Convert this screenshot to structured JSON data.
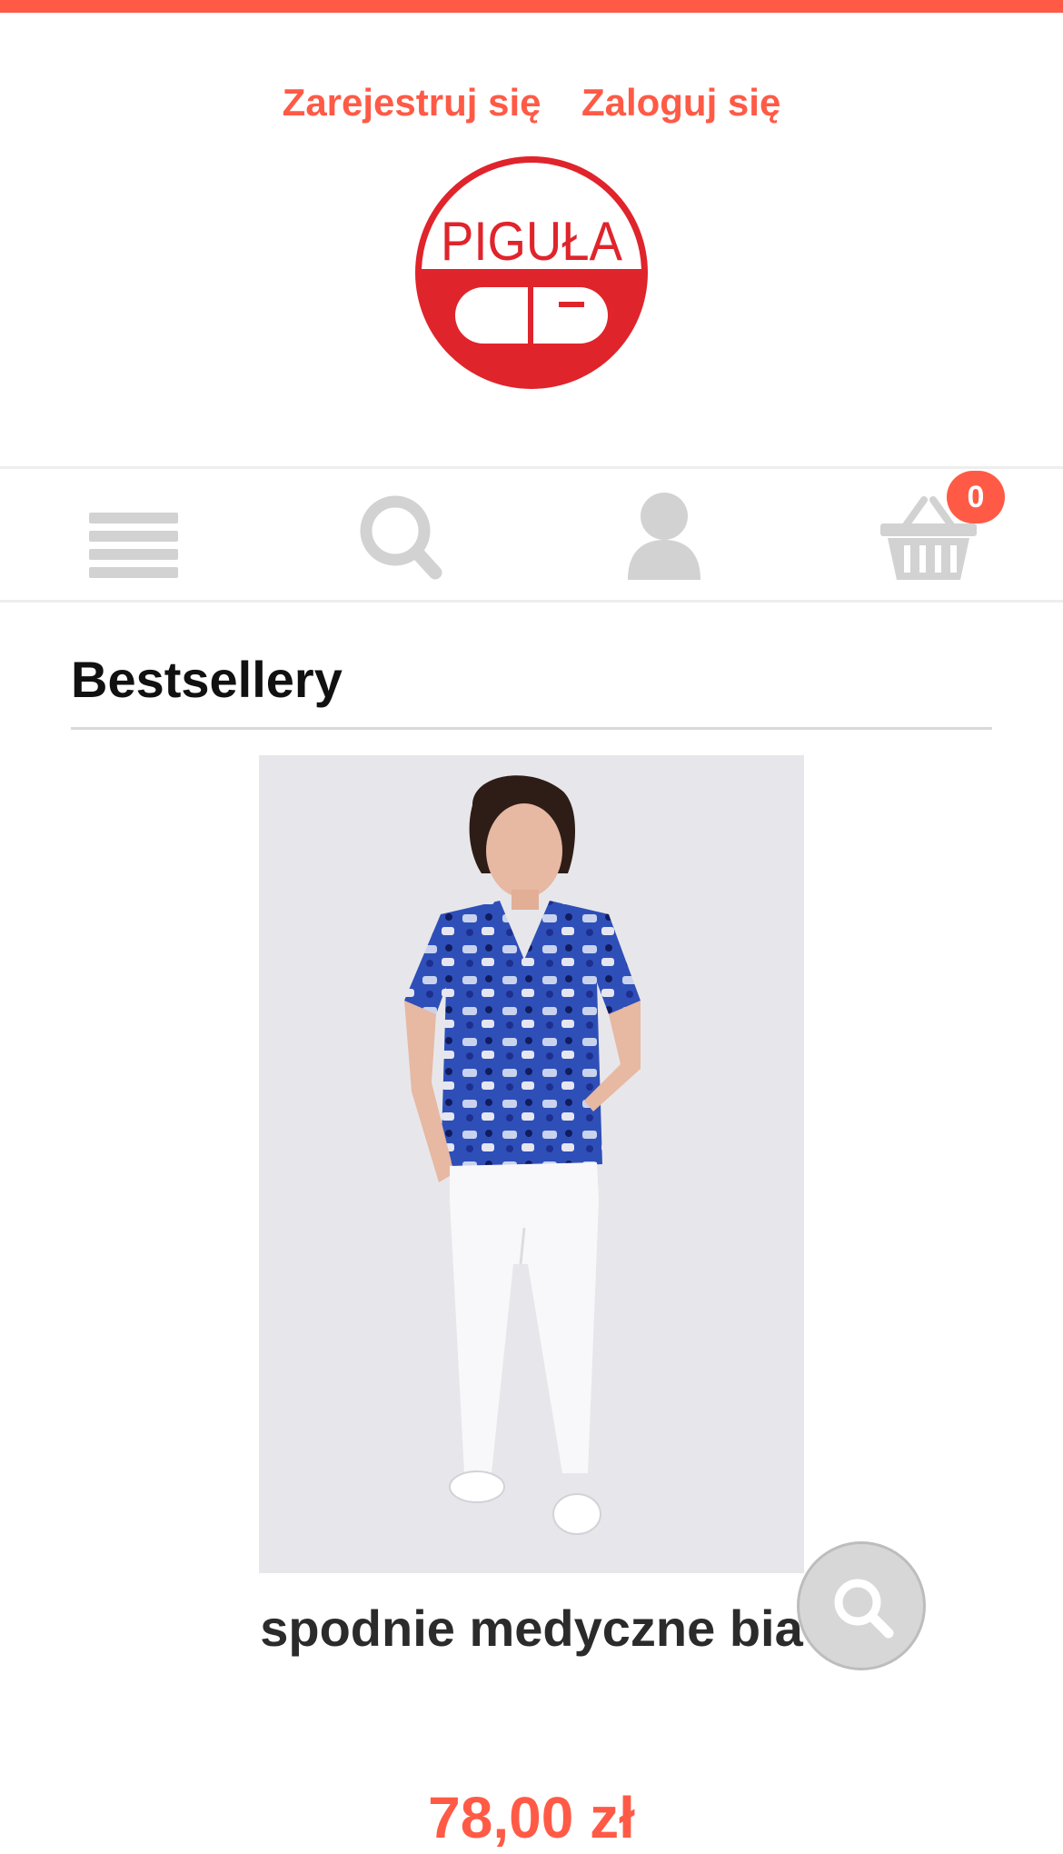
{
  "header": {
    "register_label": "Zarejestruj się",
    "login_label": "Zaloguj się",
    "logo_text": "PIGUŁA"
  },
  "icon_bar": {
    "menu_icon": "hamburger-menu-icon",
    "search_icon": "search-icon",
    "account_icon": "user-icon",
    "cart_icon": "basket-icon",
    "cart_count": "0"
  },
  "section": {
    "title": "Bestsellery"
  },
  "product": {
    "name": "spodnie medyczne bia",
    "price": "78,00 zł",
    "zoom_icon": "search-icon"
  },
  "colors": {
    "accent": "#ff5a46",
    "logo_red": "#e0242b",
    "icon_gray": "#d2d2d2"
  }
}
